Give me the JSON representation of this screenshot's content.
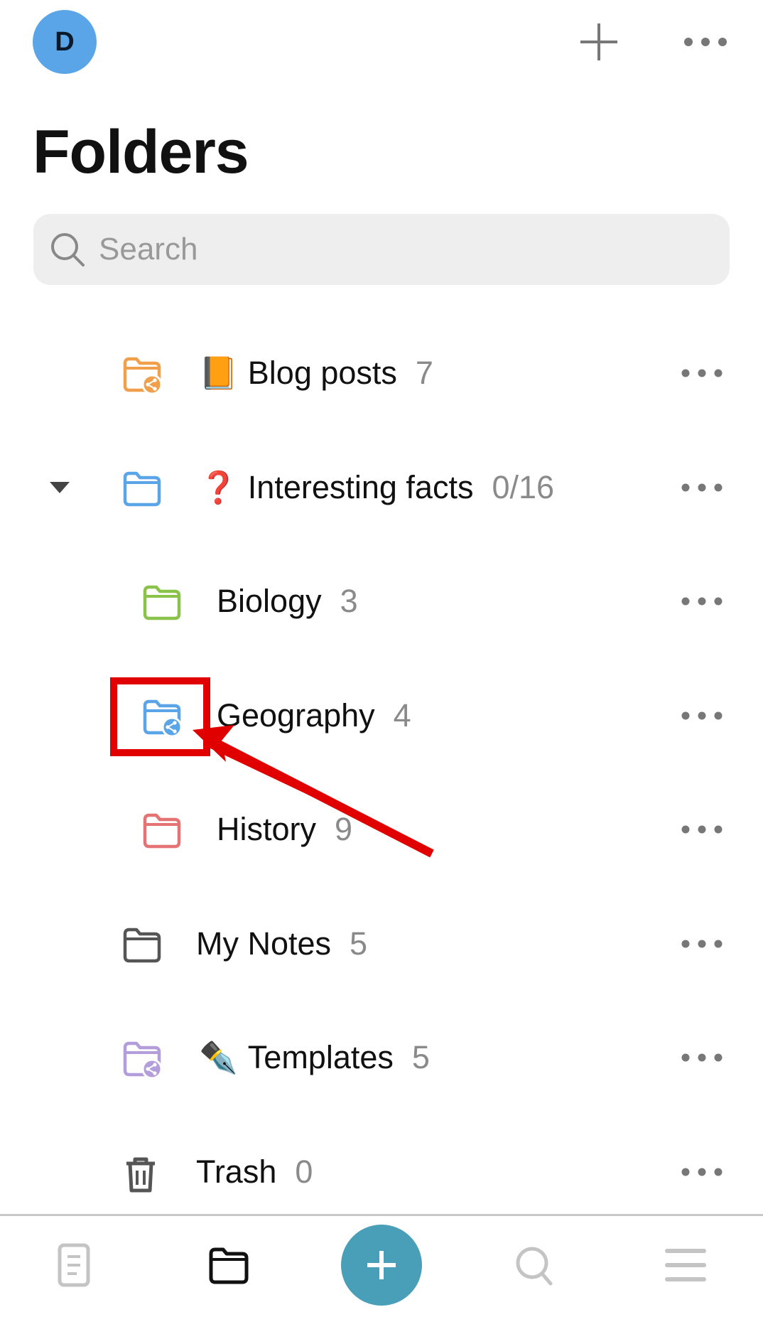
{
  "header": {
    "avatar_initial": "D",
    "add_icon": "plus-icon",
    "more_icon": "more-horizontal-icon",
    "title": "Folders"
  },
  "search": {
    "placeholder": "Search",
    "value": ""
  },
  "folders": [
    {
      "name": "Blog posts",
      "count": "7",
      "emoji": "📙",
      "icon": "shared-folder-icon",
      "color": "#f0a04b",
      "level": 0
    },
    {
      "name": "Interesting facts",
      "count": "0/16",
      "emoji": "❓",
      "icon": "folder-icon",
      "color": "#5aa5e8",
      "level": 0,
      "expanded": true
    },
    {
      "name": "Biology",
      "count": "3",
      "emoji": "",
      "icon": "folder-icon",
      "color": "#8bc34a",
      "level": 1
    },
    {
      "name": "Geography",
      "count": "4",
      "emoji": "",
      "icon": "shared-folder-icon",
      "color": "#5aa5e8",
      "level": 1,
      "highlighted": true
    },
    {
      "name": "History",
      "count": "9",
      "emoji": "",
      "icon": "folder-icon",
      "color": "#e57373",
      "level": 1
    },
    {
      "name": "My Notes",
      "count": "5",
      "emoji": "",
      "icon": "folder-icon",
      "color": "#555555",
      "level": 0
    },
    {
      "name": "Templates",
      "count": "5",
      "emoji": "✒️",
      "icon": "shared-folder-icon",
      "color": "#b39ddb",
      "level": 0
    },
    {
      "name": "Trash",
      "count": "0",
      "emoji": "",
      "icon": "trash-icon",
      "color": "#555555",
      "level": 0
    }
  ],
  "bottom_nav": [
    {
      "icon": "notes-icon",
      "active": false
    },
    {
      "icon": "folder-icon",
      "active": true
    },
    {
      "icon": "plus-icon",
      "fab": true,
      "color": "#4a9fb8"
    },
    {
      "icon": "search-icon",
      "active": false
    },
    {
      "icon": "menu-icon",
      "active": false
    }
  ],
  "annotation": {
    "color": "#e00000"
  }
}
